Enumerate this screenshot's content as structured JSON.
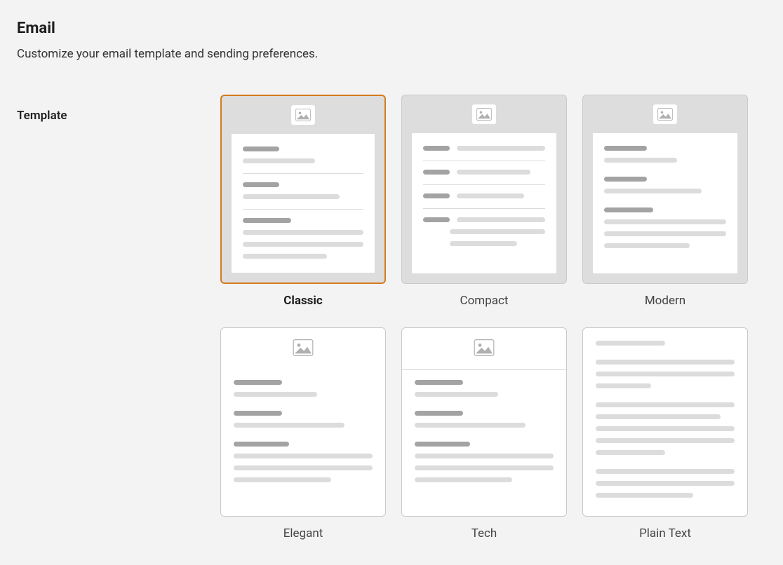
{
  "header": {
    "title": "Email",
    "subtitle": "Customize your email template and sending preferences."
  },
  "section": {
    "label": "Template"
  },
  "templates": {
    "selected": "classic",
    "options": [
      {
        "id": "classic",
        "label": "Classic"
      },
      {
        "id": "compact",
        "label": "Compact"
      },
      {
        "id": "modern",
        "label": "Modern"
      },
      {
        "id": "elegant",
        "label": "Elegant"
      },
      {
        "id": "tech",
        "label": "Tech"
      },
      {
        "id": "plain-text",
        "label": "Plain Text"
      }
    ]
  }
}
